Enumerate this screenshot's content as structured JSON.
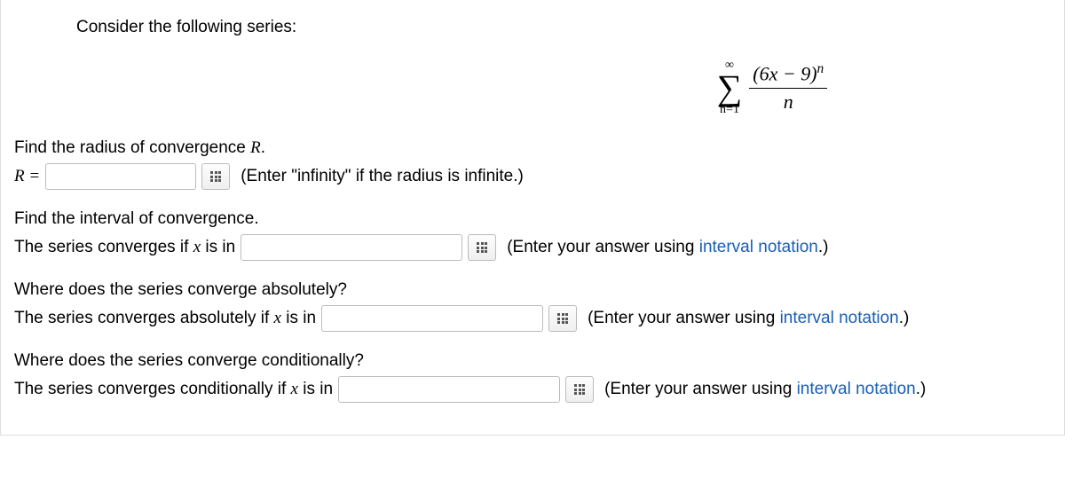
{
  "intro": "Consider the following series:",
  "formula": {
    "upper": "∞",
    "lower": "n=1",
    "numerator": "(6x − 9)",
    "numerator_exp": "n",
    "denominator": "n"
  },
  "q1": {
    "prompt": "Find the radius of convergence ",
    "var": "R",
    "period": ".",
    "label_lhs": "R =",
    "hint": "(Enter \"infinity\" if the radius is infinite.)"
  },
  "q2": {
    "prompt": "Find the interval of convergence.",
    "label": "The series converges if ",
    "var": "x",
    "label_suffix": " is in",
    "hint_prefix": "(Enter your answer using ",
    "hint_link": "interval notation",
    "hint_suffix": ".)"
  },
  "q3": {
    "prompt": "Where does the series converge absolutely?",
    "label": "The series converges absolutely if ",
    "var": "x",
    "label_suffix": " is in",
    "hint_prefix": "(Enter your answer using ",
    "hint_link": "interval notation",
    "hint_suffix": ".)"
  },
  "q4": {
    "prompt": "Where does the series converge conditionally?",
    "label": "The series converges conditionally if ",
    "var": "x",
    "label_suffix": " is in",
    "hint_prefix": "(Enter your answer using ",
    "hint_link": "interval notation",
    "hint_suffix": ".)"
  }
}
